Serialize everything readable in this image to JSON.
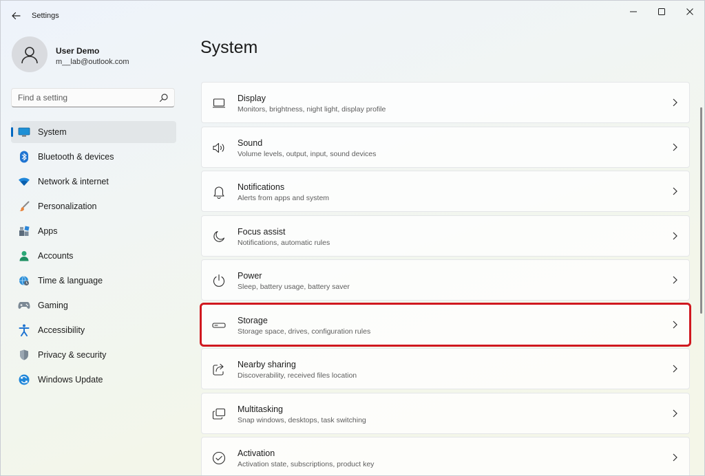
{
  "window": {
    "title": "Settings",
    "controls": [
      "minimize",
      "maximize",
      "close"
    ]
  },
  "profile": {
    "name": "User Demo",
    "email": "m__lab@outlook.com"
  },
  "search": {
    "placeholder": "Find a setting",
    "value": ""
  },
  "sidebar": {
    "items": [
      {
        "label": "System",
        "icon": "system-icon",
        "active": true
      },
      {
        "label": "Bluetooth & devices",
        "icon": "bluetooth-icon"
      },
      {
        "label": "Network & internet",
        "icon": "wifi-icon"
      },
      {
        "label": "Personalization",
        "icon": "brush-icon"
      },
      {
        "label": "Apps",
        "icon": "apps-icon"
      },
      {
        "label": "Accounts",
        "icon": "person-icon"
      },
      {
        "label": "Time & language",
        "icon": "globe-clock-icon"
      },
      {
        "label": "Gaming",
        "icon": "gamepad-icon"
      },
      {
        "label": "Accessibility",
        "icon": "accessibility-icon"
      },
      {
        "label": "Privacy & security",
        "icon": "shield-icon"
      },
      {
        "label": "Windows Update",
        "icon": "update-icon"
      }
    ]
  },
  "main": {
    "title": "System",
    "cards": [
      {
        "title": "Display",
        "desc": "Monitors, brightness, night light, display profile",
        "icon": "display-icon"
      },
      {
        "title": "Sound",
        "desc": "Volume levels, output, input, sound devices",
        "icon": "speaker-icon"
      },
      {
        "title": "Notifications",
        "desc": "Alerts from apps and system",
        "icon": "bell-icon"
      },
      {
        "title": "Focus assist",
        "desc": "Notifications, automatic rules",
        "icon": "moon-icon"
      },
      {
        "title": "Power",
        "desc": "Sleep, battery usage, battery saver",
        "icon": "power-icon"
      },
      {
        "title": "Storage",
        "desc": "Storage space, drives, configuration rules",
        "icon": "storage-icon",
        "highlighted": true
      },
      {
        "title": "Nearby sharing",
        "desc": "Discoverability, received files location",
        "icon": "share-icon"
      },
      {
        "title": "Multitasking",
        "desc": "Snap windows, desktops, task switching",
        "icon": "multitask-icon"
      },
      {
        "title": "Activation",
        "desc": "Activation state, subscriptions, product key",
        "icon": "check-circle-icon"
      }
    ]
  },
  "colors": {
    "accent": "#0067c0",
    "highlight": "#d0181f"
  }
}
